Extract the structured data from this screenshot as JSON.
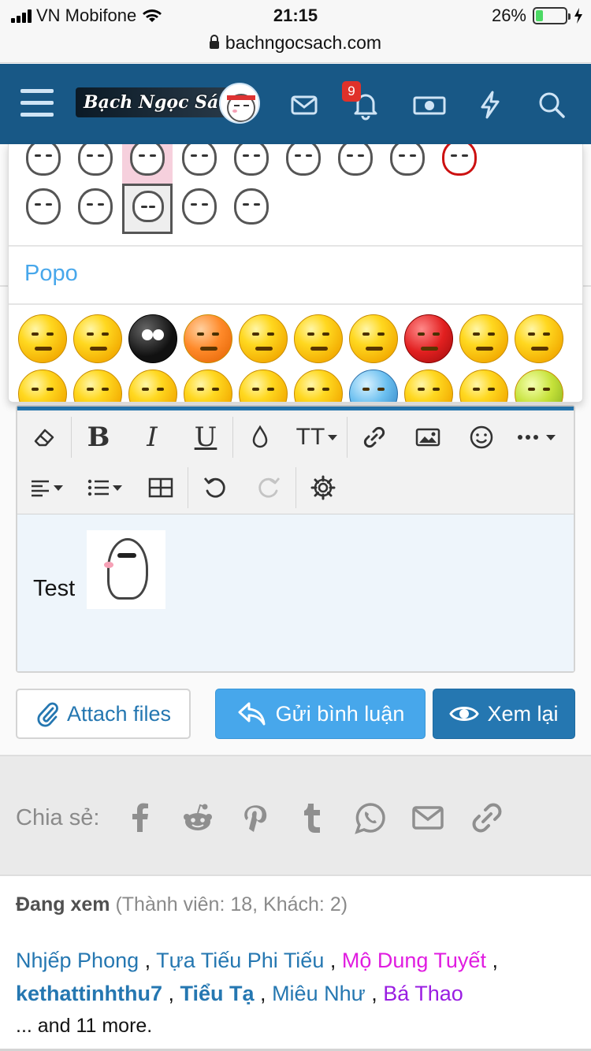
{
  "status_bar": {
    "carrier": "VN Mobifone",
    "time": "21:15",
    "battery": "26%",
    "battery_level": 0.26,
    "url": "bachngocsach.com"
  },
  "header": {
    "logo_text": "Bạch Ngọc Sách",
    "notification_count": "9",
    "icons": [
      "menu-icon",
      "avatar",
      "mail-icon",
      "bell-icon",
      "cash-icon",
      "bolt-icon",
      "search-icon"
    ],
    "background": "#185886"
  },
  "emoji_panel": {
    "section_title": "Popo"
  },
  "editor": {
    "toolbar_row1": [
      "eraser-icon",
      "bold-icon",
      "italic-icon",
      "underline-icon",
      "color-drop-icon",
      "text-size-icon",
      "link-icon",
      "image-icon",
      "smiley-icon",
      "more-icon"
    ],
    "toolbar_row2": [
      "align-icon",
      "list-icon",
      "table-icon",
      "undo-icon",
      "redo-icon",
      "settings-icon"
    ],
    "bold_label": "B",
    "italic_label": "I",
    "underline_label": "U",
    "text_size_label": "TT",
    "content_text": "Test",
    "accent": "#2577b1"
  },
  "buttons": {
    "attach": "Attach files",
    "send": "Gửi bình luận",
    "preview": "Xem lại"
  },
  "share": {
    "label": "Chia sẻ:",
    "icons": [
      "facebook-icon",
      "reddit-icon",
      "pinterest-icon",
      "tumblr-icon",
      "whatsapp-icon",
      "email-icon",
      "link-icon"
    ]
  },
  "viewing": {
    "title": "Đang xem",
    "counts": "(Thành viên: 18, Khách: 2)",
    "members": [
      {
        "name": "Nhjếp Phong",
        "style": "blue"
      },
      {
        "name": "Tựa Tiếu Phi Tiếu",
        "style": "blue"
      },
      {
        "name": "Mộ Dung Tuyết",
        "style": "pink"
      },
      {
        "name": "kethattinhthu7",
        "style": "bold"
      },
      {
        "name": "Tiểu Tạ",
        "style": "bold"
      },
      {
        "name": "Miêu Như",
        "style": "blue"
      },
      {
        "name": "Bá Thao",
        "style": "purple"
      }
    ],
    "more": "... and 11 more."
  }
}
